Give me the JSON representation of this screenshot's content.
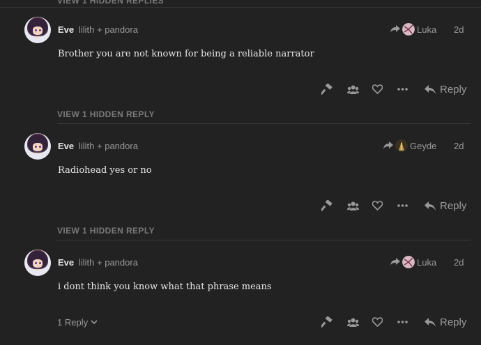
{
  "cutoff_text": "VIEW 1 HIDDEN REPLIES",
  "posts": [
    {
      "username": "Eve",
      "fullname": "lilith + pandora",
      "reply_to": "Luka",
      "date": "2d",
      "body": "Brother you are not known for being a reliable narrator",
      "reply_label": "Reply",
      "hidden_link": "VIEW 1 HIDDEN REPLY"
    },
    {
      "username": "Eve",
      "fullname": "lilith + pandora",
      "reply_to": "Geyde",
      "date": "2d",
      "body": "Radiohead yes or no",
      "reply_label": "Reply",
      "hidden_link": "VIEW 1 HIDDEN REPLY"
    },
    {
      "username": "Eve",
      "fullname": "lilith + pandora",
      "reply_to": "Luka",
      "date": "2d",
      "body": "i dont think you know what that phrase means",
      "reply_label": "Reply",
      "replies_count_label": "1 Reply"
    }
  ],
  "icons": {
    "reply_to": "share-arrow-icon",
    "hammer": "hammer-icon",
    "group": "users-icon",
    "like": "heart-icon",
    "more": "ellipsis-icon",
    "reply": "reply-icon",
    "chevron": "chevron-down-icon"
  },
  "colors": {
    "background": "#222222",
    "text": "#dddddd",
    "muted": "#9a9a9a"
  }
}
